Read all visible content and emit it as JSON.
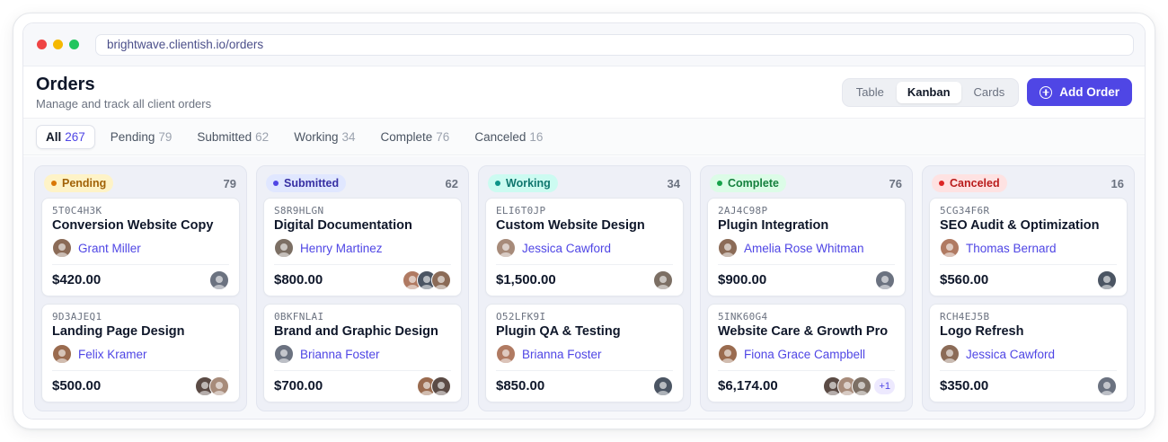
{
  "browser": {
    "url": "brightwave.clientish.io/orders",
    "dots": [
      "#ef4444",
      "#f5b800",
      "#22c55e"
    ]
  },
  "header": {
    "title": "Orders",
    "subtitle": "Manage and track all client orders",
    "views": [
      "Table",
      "Kanban",
      "Cards"
    ],
    "active_view": "Kanban",
    "add_label": "Add Order",
    "add_icon": "plus-circle-icon"
  },
  "filters": [
    {
      "label": "All",
      "count": "267",
      "active": true
    },
    {
      "label": "Pending",
      "count": "79"
    },
    {
      "label": "Submitted",
      "count": "62"
    },
    {
      "label": "Working",
      "count": "34"
    },
    {
      "label": "Complete",
      "count": "76"
    },
    {
      "label": "Canceled",
      "count": "16"
    }
  ],
  "columns": [
    {
      "status": "Pending",
      "count": "79",
      "colors": {
        "bg": "#fef3c7",
        "fg": "#a16207",
        "dot": "#d97706"
      },
      "cards": [
        {
          "id": "5T0C4H3K",
          "name": "Conversion Website Copy",
          "client": "Grant Miller",
          "price": "$420.00",
          "team": 1
        },
        {
          "id": "9D3AJEQ1",
          "name": "Landing Page Design",
          "client": "Felix Kramer",
          "price": "$500.00",
          "team": 2
        }
      ]
    },
    {
      "status": "Submitted",
      "count": "62",
      "colors": {
        "bg": "#e0e7ff",
        "fg": "#3730a3",
        "dot": "#4f46e5"
      },
      "cards": [
        {
          "id": "S8R9HLGN",
          "name": "Digital Documentation",
          "client": "Henry Martinez",
          "price": "$800.00",
          "team": 3
        },
        {
          "id": "0BKFNLAI",
          "name": "Brand and Graphic Design",
          "client": "Brianna Foster",
          "price": "$700.00",
          "team": 2
        }
      ]
    },
    {
      "status": "Working",
      "count": "34",
      "colors": {
        "bg": "#ccfbf1",
        "fg": "#0f766e",
        "dot": "#0d9488"
      },
      "cards": [
        {
          "id": "ELI6T0JP",
          "name": "Custom Website Design",
          "client": "Jessica Cawford",
          "price": "$1,500.00",
          "team": 1
        },
        {
          "id": "O52LFK9I",
          "name": "Plugin QA & Testing",
          "client": "Brianna Foster",
          "price": "$850.00",
          "team": 1
        }
      ]
    },
    {
      "status": "Complete",
      "count": "76",
      "colors": {
        "bg": "#dcfce7",
        "fg": "#15803d",
        "dot": "#16a34a"
      },
      "cards": [
        {
          "id": "2AJ4C98P",
          "name": "Plugin Integration",
          "client": "Amelia Rose Whitman",
          "price": "$900.00",
          "team": 1
        },
        {
          "id": "5INK60G4",
          "name": "Website Care & Growth Pro",
          "client": "Fiona Grace Campbell",
          "price": "$6,174.00",
          "team": 3,
          "more": "+1"
        }
      ]
    },
    {
      "status": "Canceled",
      "count": "16",
      "colors": {
        "bg": "#fee2e2",
        "fg": "#b91c1c",
        "dot": "#dc2626"
      },
      "cards": [
        {
          "id": "5CG34F6R",
          "name": "SEO Audit & Optimization",
          "client": "Thomas Bernard",
          "price": "$560.00",
          "team": 1
        },
        {
          "id": "RCH4EJ5B",
          "name": "Logo Refresh",
          "client": "Jessica Cawford",
          "price": "$350.00",
          "team": 1
        }
      ]
    }
  ],
  "avatar_colors": [
    "#8b6b57",
    "#6b7280",
    "#9a6b4f",
    "#5b4b45",
    "#a78b7a",
    "#7c6f64",
    "#b07a62",
    "#4b5563"
  ]
}
